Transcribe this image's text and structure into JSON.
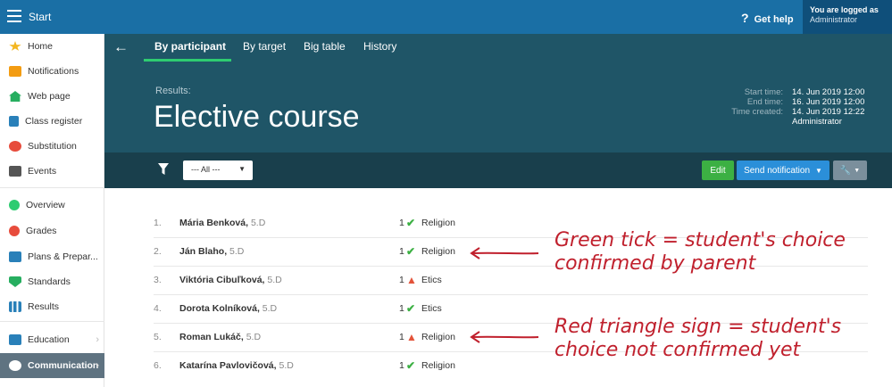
{
  "topbar": {
    "app_title": "Start",
    "help_label": "Get help",
    "logged_in_label": "You are logged as",
    "user_role": "Administrator"
  },
  "sidebar": {
    "items": [
      {
        "label": "Home",
        "icon": "star-icon",
        "color": "#f3b61f"
      },
      {
        "label": "Notifications",
        "icon": "envelope-icon",
        "color": "#f39c12"
      },
      {
        "label": "Web page",
        "icon": "house-icon",
        "color": "#27ae60"
      },
      {
        "label": "Class register",
        "icon": "book-icon",
        "color": "#2980b9"
      },
      {
        "label": "Substitution",
        "icon": "person-icon",
        "color": "#e74c3c"
      },
      {
        "label": "Events",
        "icon": "calendar-icon",
        "color": "#555555"
      },
      {
        "label": "Overview",
        "icon": "check-circle-icon",
        "color": "#2ecc71"
      },
      {
        "label": "Grades",
        "icon": "grades-icon",
        "color": "#e74c3c"
      },
      {
        "label": "Plans & Prepar...",
        "icon": "briefcase-icon",
        "color": "#2980b9"
      },
      {
        "label": "Standards",
        "icon": "shield-icon",
        "color": "#27ae60"
      },
      {
        "label": "Results",
        "icon": "bar-chart-icon",
        "color": "#2980b9"
      },
      {
        "label": "Education",
        "icon": "education-icon",
        "color": "#2980b9"
      },
      {
        "label": "Communication",
        "icon": "chat-icon",
        "color": "#ffffff"
      }
    ]
  },
  "tabs": [
    "By participant",
    "By target",
    "Big table",
    "History"
  ],
  "header": {
    "results_label": "Results:",
    "title": "Elective course",
    "start_time_label": "Start time:",
    "end_time_label": "End time:",
    "time_created_label": "Time created:",
    "start_time": "14. Jun 2019 12:00",
    "end_time": "16. Jun 2019 12:00",
    "time_created": "14. Jun 2019 12:22",
    "created_by": "Administrator"
  },
  "filter": {
    "selected": "--- All ---",
    "edit_label": "Edit",
    "send_label": "Send notification"
  },
  "rows": [
    {
      "num": "1.",
      "name": "Mária Benková",
      "cls": "5.D",
      "count": "1",
      "status": "confirmed",
      "subject": "Religion"
    },
    {
      "num": "2.",
      "name": "Ján Blaho",
      "cls": "5.D",
      "count": "1",
      "status": "confirmed",
      "subject": "Religion"
    },
    {
      "num": "3.",
      "name": "Viktória Cibuľková",
      "cls": "5.D",
      "count": "1",
      "status": "unconfirmed",
      "subject": "Etics"
    },
    {
      "num": "4.",
      "name": "Dorota Kolníková",
      "cls": "5.D",
      "count": "1",
      "status": "confirmed",
      "subject": "Etics"
    },
    {
      "num": "5.",
      "name": "Roman Lukáč",
      "cls": "5.D",
      "count": "1",
      "status": "unconfirmed",
      "subject": "Religion"
    },
    {
      "num": "6.",
      "name": "Katarína Pavlovičová",
      "cls": "5.D",
      "count": "1",
      "status": "confirmed",
      "subject": "Religion"
    }
  ],
  "annotations": {
    "green_line1": "Green tick = student's choice",
    "green_line2": "confirmed by parent",
    "red_line1": "Red triangle sign = student's",
    "red_line2": "choice not confirmed yet"
  },
  "colors": {
    "topbar": "#1a6fa5",
    "header": "#1f5567",
    "filterbar": "#193f4c",
    "tick": "#3cb043",
    "warning": "#e3533a",
    "annotation": "#c0202d"
  }
}
